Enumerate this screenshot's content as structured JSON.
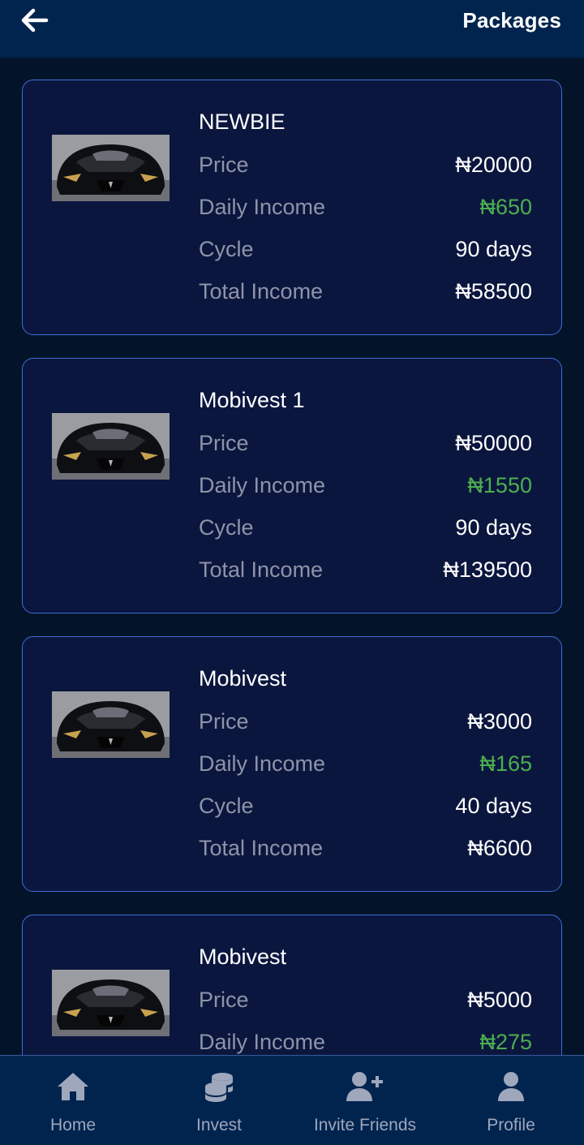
{
  "header": {
    "title": "Packages",
    "back_icon": "arrow-left-icon"
  },
  "labels": {
    "price": "Price",
    "daily_income": "Daily Income",
    "cycle": "Cycle",
    "total_income": "Total Income"
  },
  "packages": [
    {
      "name": "NEWBIE",
      "price": "₦20000",
      "daily_income": "₦650",
      "cycle": "90 days",
      "total_income": "₦58500"
    },
    {
      "name": "Mobivest 1",
      "price": "₦50000",
      "daily_income": "₦1550",
      "cycle": "90 days",
      "total_income": "₦139500"
    },
    {
      "name": "Mobivest",
      "price": "₦3000",
      "daily_income": "₦165",
      "cycle": "40 days",
      "total_income": "₦6600"
    },
    {
      "name": "Mobivest",
      "price": "₦5000",
      "daily_income": "₦275",
      "cycle": "",
      "total_income": ""
    }
  ],
  "nav": [
    {
      "label": "Home",
      "icon": "home-icon"
    },
    {
      "label": "Invest",
      "icon": "coins-icon"
    },
    {
      "label": "Invite Friends",
      "icon": "add-user-icon"
    },
    {
      "label": "Profile",
      "icon": "user-icon"
    }
  ],
  "colors": {
    "background": "#03142a",
    "header": "#01244f",
    "card": "#0b163e",
    "card_border": "#3f6bd6",
    "income_green": "#4caf50",
    "label_gray": "#8e94a8"
  }
}
